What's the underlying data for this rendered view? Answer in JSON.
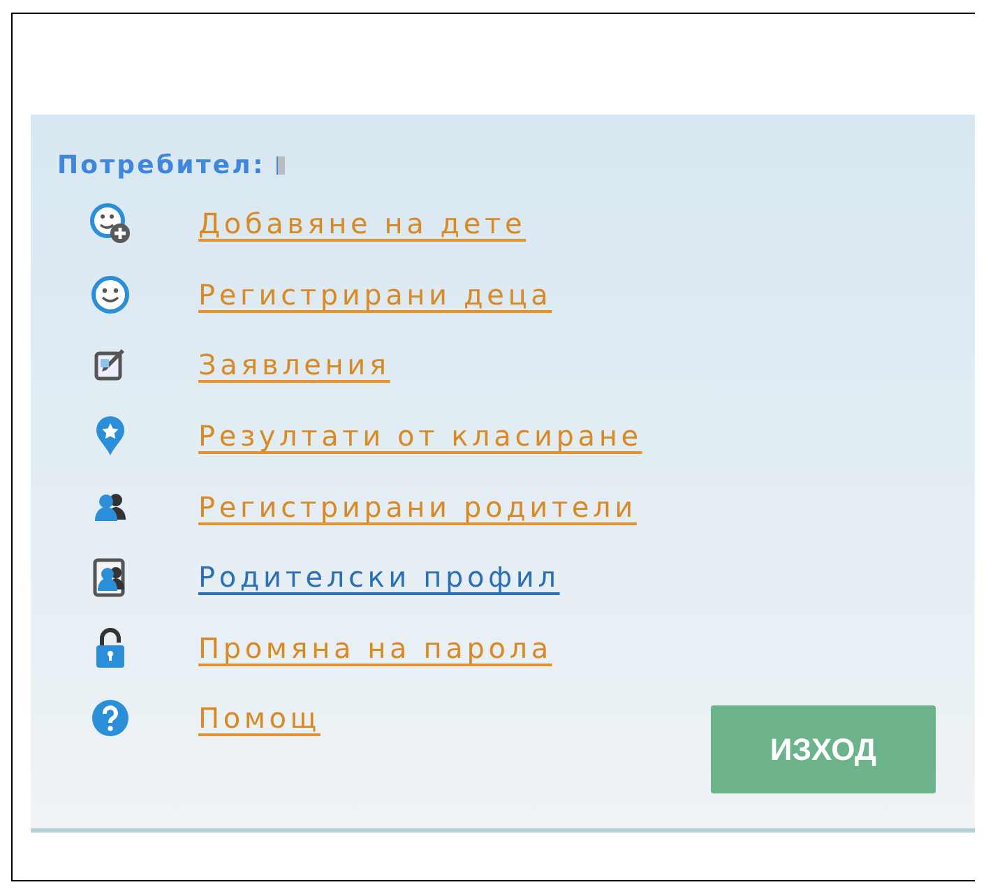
{
  "user": {
    "label": "Потребител:"
  },
  "menu": [
    {
      "label": "Добавяне на дете",
      "selected": false
    },
    {
      "label": "Регистрирани деца",
      "selected": false
    },
    {
      "label": "Заявления",
      "selected": false
    },
    {
      "label": "Резултати от класиране",
      "selected": false
    },
    {
      "label": "Регистрирани родители",
      "selected": false
    },
    {
      "label": "Родителски профил",
      "selected": true
    },
    {
      "label": "Промяна на парола",
      "selected": false
    },
    {
      "label": "Помощ",
      "selected": false
    }
  ],
  "logout": {
    "label": "ИЗХОД"
  }
}
